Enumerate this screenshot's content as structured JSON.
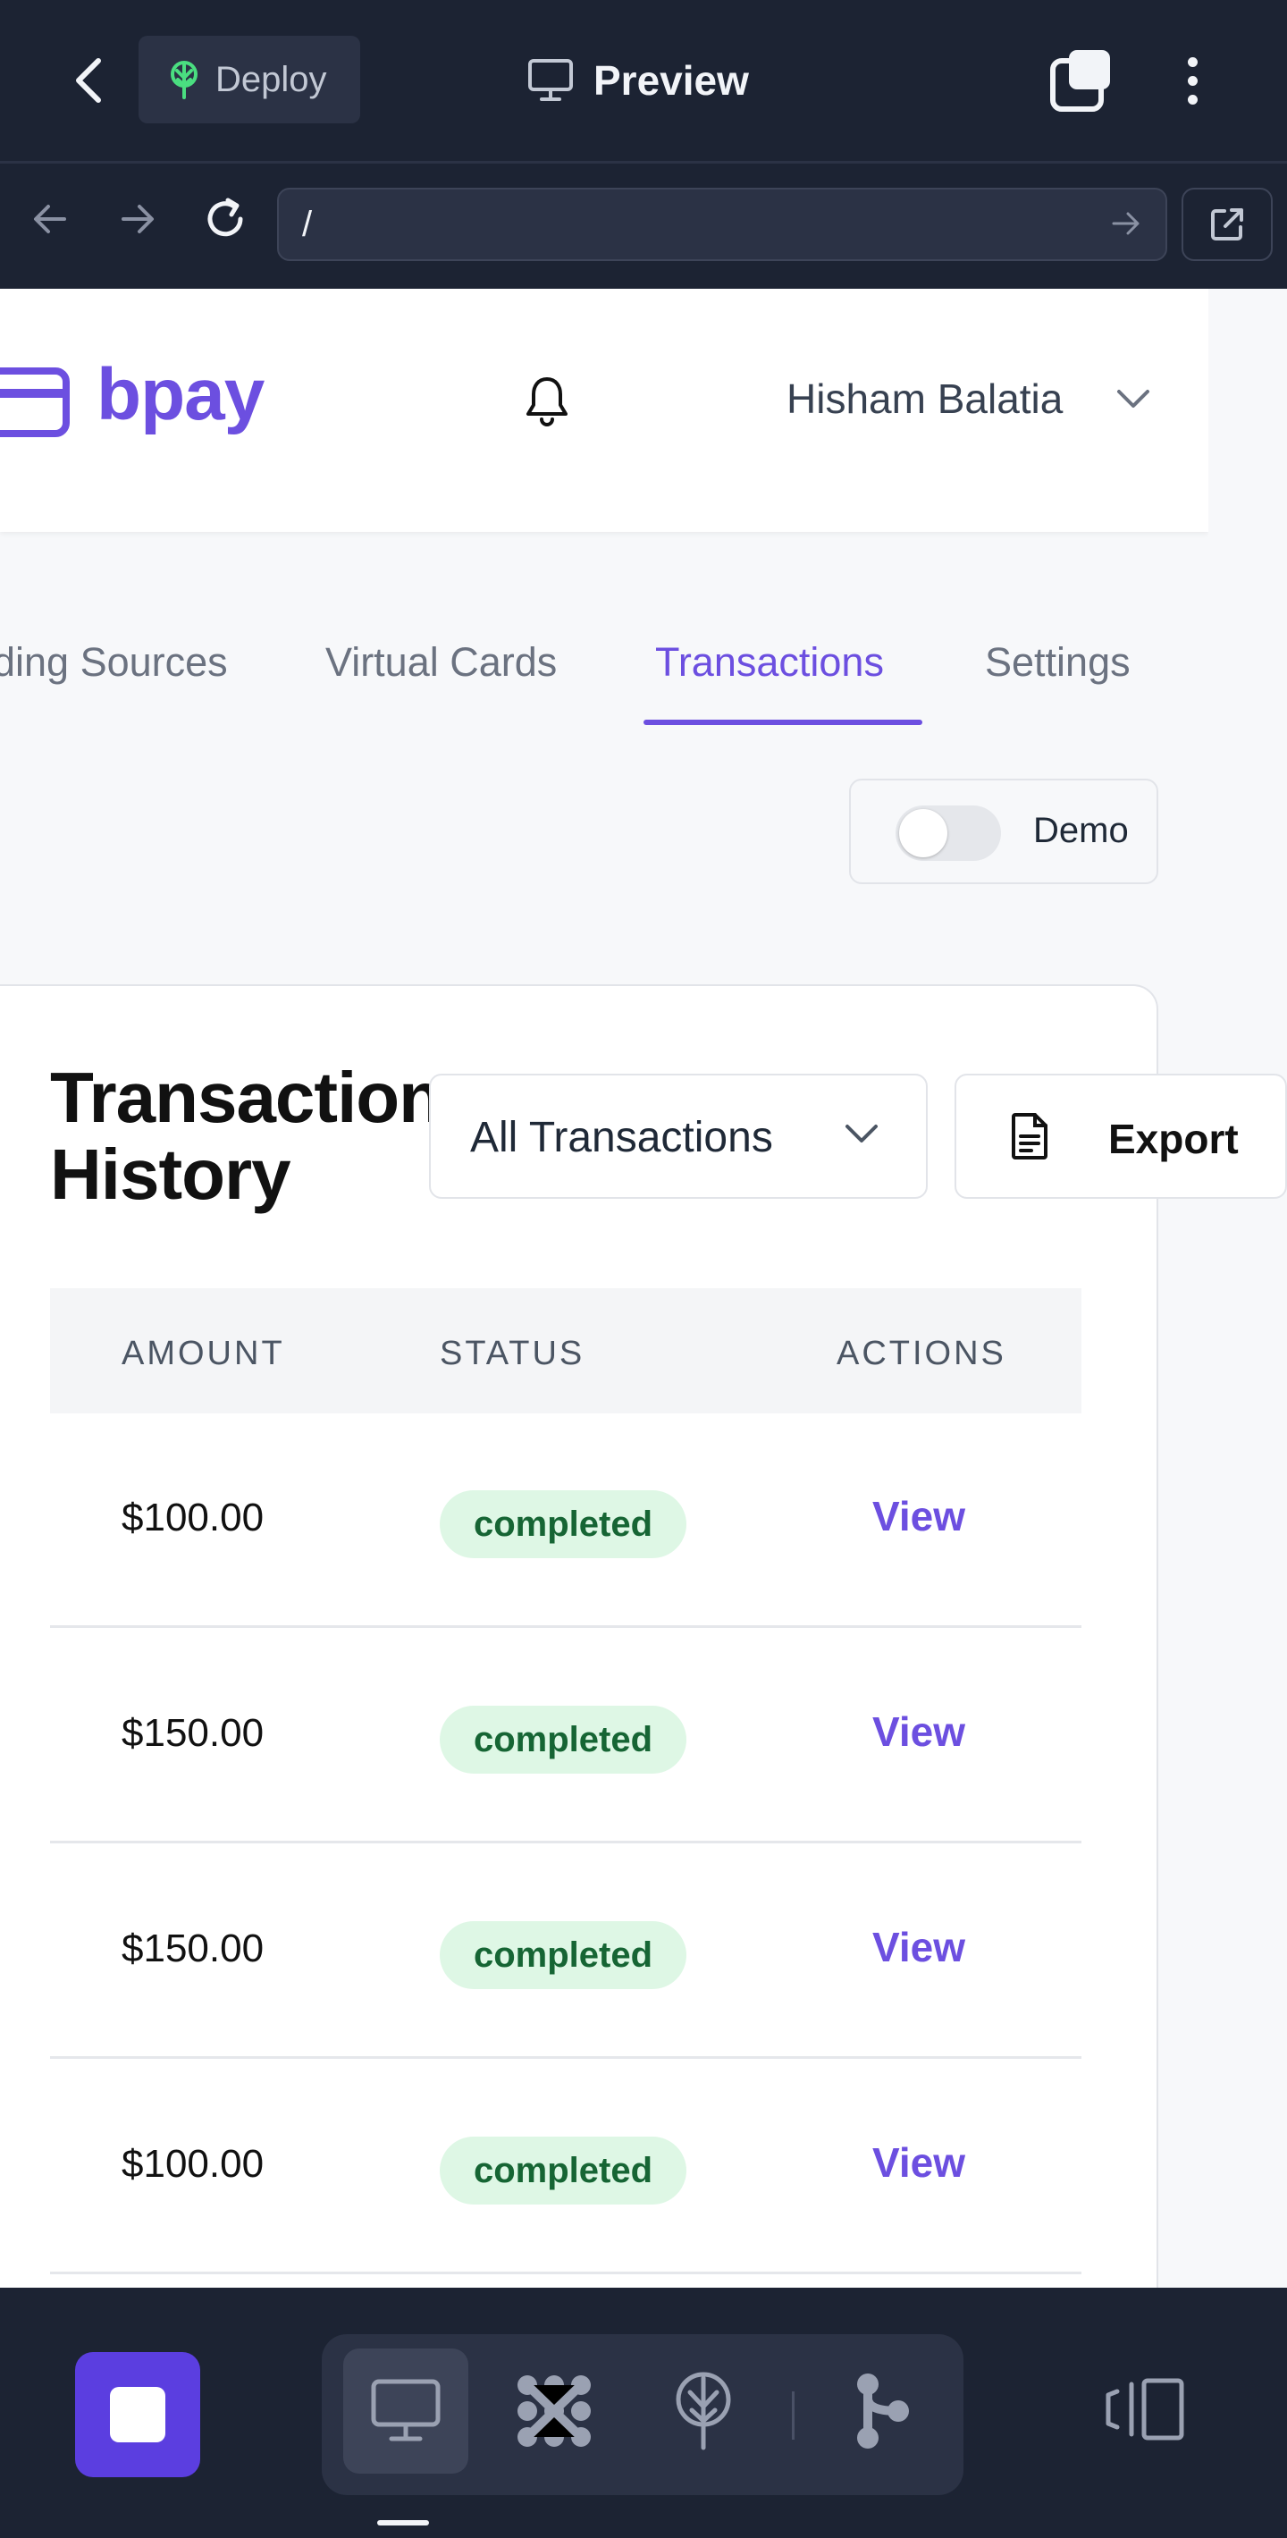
{
  "topbar": {
    "deploy_label": "Deploy",
    "title": "Preview"
  },
  "browser": {
    "url": "/"
  },
  "app": {
    "brand": "bpay",
    "user_name": "Hisham Balatia",
    "nav_tabs": [
      {
        "label": "ding Sources"
      },
      {
        "label": "Virtual Cards"
      },
      {
        "label": "Transactions",
        "active": true
      },
      {
        "label": "Settings"
      }
    ],
    "demo_label": "Demo",
    "demo_enabled": false,
    "card": {
      "title_line1": "Transaction",
      "title_line2": "History",
      "filter_selected": "All Transactions",
      "export_label": "Export"
    },
    "table": {
      "headers": [
        "AMOUNT",
        "STATUS",
        "ACTIONS"
      ],
      "rows": [
        {
          "amount": "$100.00",
          "status": "completed",
          "action": "View"
        },
        {
          "amount": "$150.00",
          "status": "completed",
          "action": "View"
        },
        {
          "amount": "$150.00",
          "status": "completed",
          "action": "View"
        },
        {
          "amount": "$100.00",
          "status": "completed",
          "action": "View"
        }
      ]
    }
  },
  "colors": {
    "accent": "#6c4fe0",
    "chrome_bg": "#1c2333",
    "status_bg": "#def7e5",
    "status_text": "#166534"
  },
  "icons": {
    "deploy": "deploy-tree-icon",
    "preview": "monitor-icon",
    "tabs": "tabs-icon",
    "menu": "kebab-menu-icon",
    "back": "chevron-left-icon",
    "bell": "bell-icon",
    "export": "document-icon"
  }
}
